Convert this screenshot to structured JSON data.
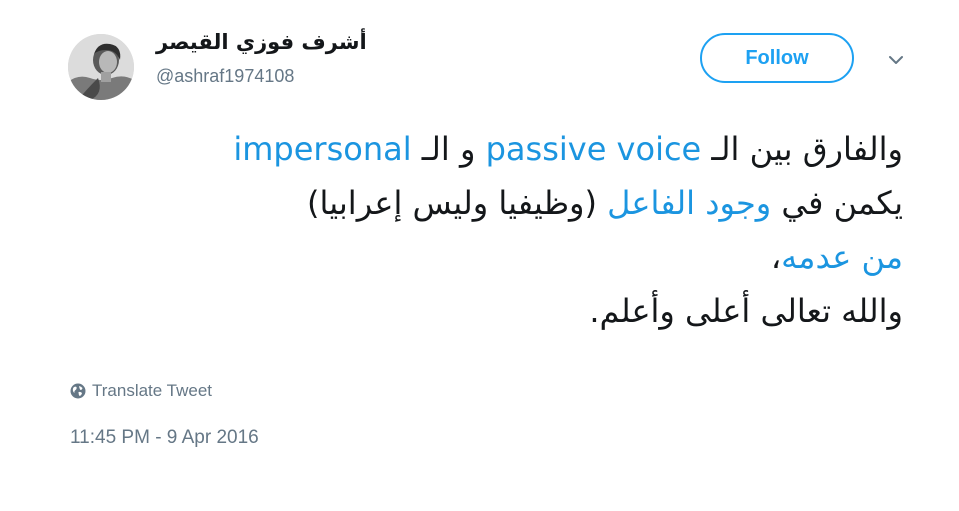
{
  "author": {
    "display_name": "أشرف فوزي القيصر",
    "handle": "@ashraf1974108",
    "avatar_icon": "profile-photo"
  },
  "actions": {
    "follow_label": "Follow",
    "more_icon": "chevron-down-icon"
  },
  "tweet": {
    "line1": {
      "prefix": "والفارق بين الـ ",
      "link1": "passive voice",
      "middle": " و الـ ",
      "link2": "impersonal"
    },
    "line2": {
      "prefix": "يكمن في ",
      "link": "وجود الفاعل",
      "suffix": " (وظيفيا وليس إعرابيا)"
    },
    "line3": {
      "link": "من عدمه",
      "suffix": "،"
    },
    "line4": {
      "text": "والله تعالى أعلى وأعلم."
    }
  },
  "translate": {
    "label": "Translate Tweet",
    "icon": "globe-icon"
  },
  "timestamp": "11:45 PM - 9 Apr 2016",
  "colors": {
    "accent": "#1da1f2",
    "link": "#1b95e0",
    "text": "#14171a",
    "muted": "#657786"
  }
}
